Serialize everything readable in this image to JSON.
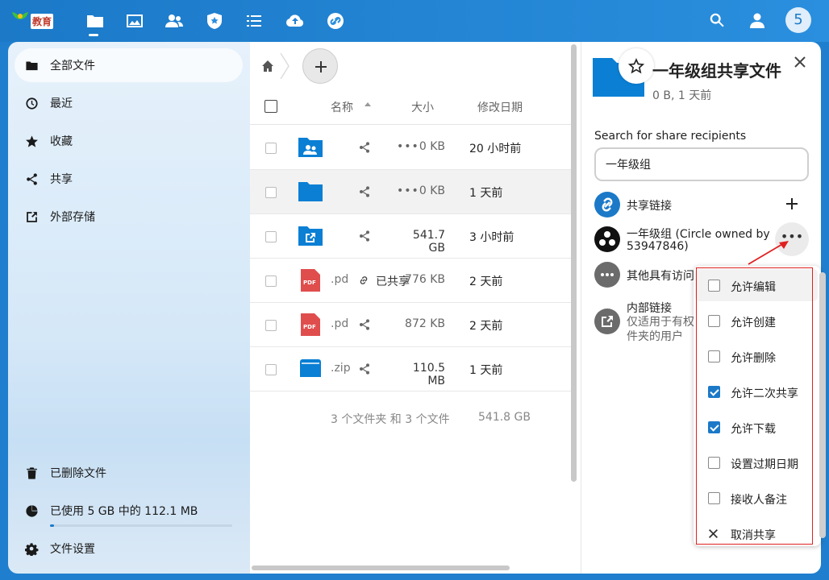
{
  "topbar": {
    "logo_text": "教育",
    "avatar_letter": "5",
    "nav_icons": [
      "files-icon",
      "photos-icon",
      "contacts-icon",
      "circles-icon",
      "activity-icon",
      "upload-icon",
      "link-icon"
    ],
    "right_icons": [
      "search-icon",
      "contacts-menu-icon"
    ]
  },
  "sidebar": {
    "items": [
      {
        "label": "全部文件",
        "icon": "folder-icon"
      },
      {
        "label": "最近",
        "icon": "clock-icon"
      },
      {
        "label": "收藏",
        "icon": "star-icon"
      },
      {
        "label": "共享",
        "icon": "share-icon"
      },
      {
        "label": "外部存储",
        "icon": "external-icon"
      }
    ],
    "trash": "已删除文件",
    "quota": "已使用 5 GB 中的 112.1 MB",
    "quota_fraction": 0.022,
    "settings": "文件设置"
  },
  "files": {
    "columns": {
      "name": "名称",
      "size": "大小",
      "modified": "修改日期"
    },
    "rows": [
      {
        "type": "shared-folder",
        "ext": "",
        "size": "0 KB",
        "modified": "20 小时前",
        "shared_label": ""
      },
      {
        "type": "folder",
        "ext": "",
        "size": "0 KB",
        "modified": "1 天前",
        "shared_label": ""
      },
      {
        "type": "external-folder",
        "ext": "",
        "size": "541.7 GB",
        "modified": "3 小时前",
        "shared_label": ""
      },
      {
        "type": "pdf",
        "ext": ".pd",
        "size": "776 KB",
        "modified": "2 天前",
        "shared_label": "已共享"
      },
      {
        "type": "pdf",
        "ext": ".pd",
        "size": "872 KB",
        "modified": "2 天前",
        "shared_label": ""
      },
      {
        "type": "zip",
        "ext": ".zip",
        "size": "110.5 MB",
        "modified": "1 天前",
        "shared_label": ""
      }
    ],
    "summary": "3 个文件夹 和 3 个文件",
    "summary_size": "541.8 GB"
  },
  "panel": {
    "title": "一年级组共享文件",
    "subtitle": "0 B, 1 天前",
    "search_label": "Search for share recipients",
    "search_value": "一年级组",
    "share_link": "共享链接",
    "circle_line1": "一年级组 (Circle owned by",
    "circle_line2": "53947846)",
    "others": "其他具有访问",
    "internal_title": "内部链接",
    "internal_line1": "仅适用于有权",
    "internal_line2": "件夹的用户",
    "more_dots": "•••"
  },
  "menu": {
    "items": [
      {
        "label": "允许编辑",
        "checked": false
      },
      {
        "label": "允许创建",
        "checked": false
      },
      {
        "label": "允许删除",
        "checked": false
      },
      {
        "label": "允许二次共享",
        "checked": true
      },
      {
        "label": "允许下载",
        "checked": true
      },
      {
        "label": "设置过期日期",
        "checked": false
      },
      {
        "label": "接收人备注",
        "checked": false
      }
    ],
    "unshare": "取消共享"
  },
  "colors": {
    "primary": "#1b79c8",
    "folder": "#0a7fd4",
    "pdf": "#e04d4d"
  }
}
